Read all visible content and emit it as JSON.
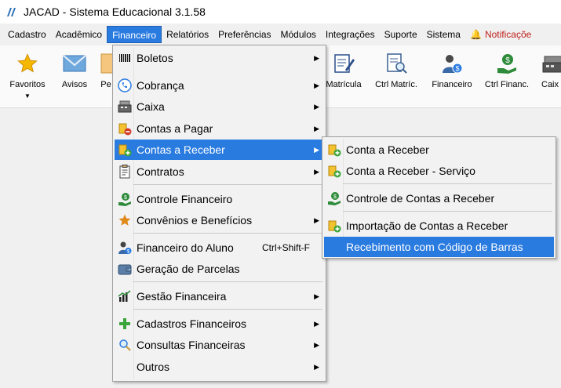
{
  "window": {
    "title": "JACAD - Sistema Educacional 3.1.58"
  },
  "menubar": {
    "items": [
      "Cadastro",
      "Acadêmico",
      "Financeiro",
      "Relatórios",
      "Preferências",
      "Módulos",
      "Integrações",
      "Suporte",
      "Sistema"
    ],
    "notifications": "Notificaçõe",
    "active": "Financeiro"
  },
  "toolbar": {
    "favoritos": "Favoritos",
    "avisos": "Avisos",
    "pe": "Pe",
    "matricula": "Matrícula",
    "ctrl_matric": "Ctrl Matríc.",
    "financeiro": "Financeiro",
    "ctrl_financ": "Ctrl Financ.",
    "caixa": "Caix"
  },
  "financeiro_menu": [
    {
      "label": "Boletos",
      "icon": "barcode-icon",
      "submenu": true
    },
    {
      "label": "Cobrança",
      "icon": "phone-icon",
      "submenu": true
    },
    {
      "label": "Caixa",
      "icon": "cash-register-icon",
      "submenu": true
    },
    {
      "label": "Contas a Pagar",
      "icon": "coins-minus-icon",
      "submenu": true
    },
    {
      "label": "Contas a Receber",
      "icon": "coins-plus-icon",
      "submenu": true,
      "selected": true
    },
    {
      "label": "Contratos",
      "icon": "contract-icon",
      "submenu": true
    },
    {
      "label": "Controle Financeiro",
      "icon": "money-hand-icon",
      "submenu": false
    },
    {
      "label": "Convênios e Benefícios",
      "icon": "star-icon",
      "submenu": true
    },
    {
      "label": "Financeiro do Aluno",
      "icon": "student-money-icon",
      "shortcut": "Ctrl+Shift-F"
    },
    {
      "label": "Geração de Parcelas",
      "icon": "wallet-icon",
      "submenu": false
    },
    {
      "label": "Gestão Financeira",
      "icon": "chart-icon",
      "submenu": true
    },
    {
      "label": "Cadastros Financeiros",
      "icon": "plus-icon",
      "submenu": true
    },
    {
      "label": "Consultas Financeiras",
      "icon": "magnifier-icon",
      "submenu": true
    },
    {
      "label": "Outros",
      "icon": "",
      "submenu": true
    }
  ],
  "receber_menu": [
    {
      "label": "Conta a Receber",
      "icon": "coins-plus-icon"
    },
    {
      "label": "Conta a Receber - Serviço",
      "icon": "coins-plus-icon"
    },
    {
      "label": "Controle de Contas a Receber",
      "icon": "money-hand-icon"
    },
    {
      "label": "Importação de Contas a Receber",
      "icon": "coins-plus-icon"
    },
    {
      "label": "Recebimento com Código de Barras",
      "icon": "",
      "selected": true
    }
  ],
  "colors": {
    "selection": "#2a7be0",
    "notification": "#c0201a",
    "menu_bg": "#f2f2f2"
  }
}
